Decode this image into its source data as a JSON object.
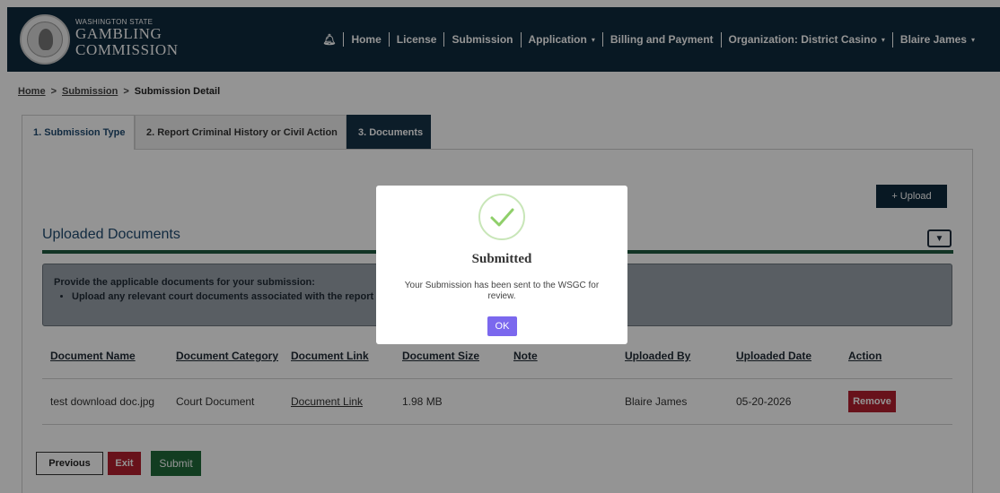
{
  "header": {
    "brand_small": "WASHINGTON STATE",
    "brand_line1": "GAMBLING",
    "brand_line2": "COMMISSION",
    "nav": {
      "home": "Home",
      "license": "License",
      "submission": "Submission",
      "application": "Application",
      "billing": "Billing and Payment",
      "organization": "Organization: District Casino",
      "user": "Blaire James"
    },
    "bg_color": "#0f2a3d"
  },
  "breadcrumb": {
    "home": "Home",
    "submission": "Submission",
    "current": "Submission Detail",
    "separator": ">"
  },
  "tabs": [
    {
      "label": "1. Submission Type"
    },
    {
      "label": "2. Report Criminal History or Civil Action"
    },
    {
      "label": "3. Documents"
    }
  ],
  "upload_button": "+ Upload",
  "section": {
    "title": "Uploaded Documents",
    "toggle_symbol": "▼"
  },
  "info": {
    "heading": "Provide the applicable documents for your submission:",
    "bullet": "Upload any relevant court documents associated with the report"
  },
  "table": {
    "headers": {
      "name": "Document Name",
      "category": "Document Category",
      "link": "Document Link",
      "size": "Document Size",
      "note": "Note",
      "uploaded_by": "Uploaded By",
      "uploaded_date": "Uploaded Date",
      "action": "Action"
    },
    "rows": [
      {
        "name": "test download doc.jpg",
        "category": "Court Document",
        "link": "Document Link",
        "size": "1.98 MB",
        "note": "",
        "uploaded_by": "Blaire James",
        "uploaded_date": "05-20-2026",
        "action": "Remove"
      }
    ]
  },
  "buttons": {
    "previous": "Previous",
    "exit": "Exit",
    "submit": "Submit"
  },
  "modal": {
    "title": "Submitted",
    "message": "Your Submission has been sent to the WSGC for review.",
    "ok": "OK",
    "icon": "check-circle-icon",
    "ok_color": "#7b68ee"
  },
  "colors": {
    "primary_navy": "#0f2a3d",
    "danger_red": "#b3202f",
    "success_green": "#1f6a3a"
  }
}
